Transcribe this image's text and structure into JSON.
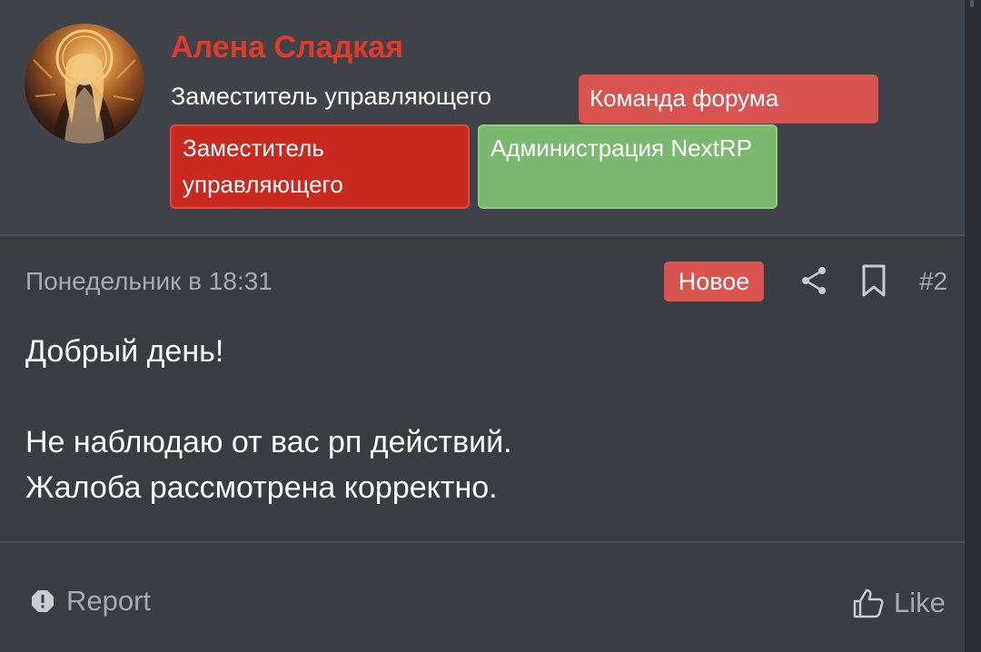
{
  "user": {
    "name": "Алена Сладкая",
    "title": "Заместитель управляющего",
    "name_color": "#e03a2a",
    "badges": [
      {
        "label": "Команда форума",
        "color": "#d9534f"
      },
      {
        "label": "Заместитель управляющего",
        "color": "#c9291f"
      },
      {
        "label": "Администрация NextRP",
        "color": "#7bb870"
      }
    ]
  },
  "post": {
    "date": "Понедельник в 18:31",
    "new_label": "Новое",
    "number": "#2",
    "message": [
      "Добрый день!",
      "",
      "Не наблюдаю от вас рп действий.",
      "Жалоба рассмотрена корректно."
    ]
  },
  "actions": {
    "report_label": "Report",
    "like_label": "Like"
  },
  "icons": {
    "share": "share-icon",
    "bookmark": "bookmark-icon",
    "report": "alert-icon",
    "like": "thumbs-up-icon"
  }
}
